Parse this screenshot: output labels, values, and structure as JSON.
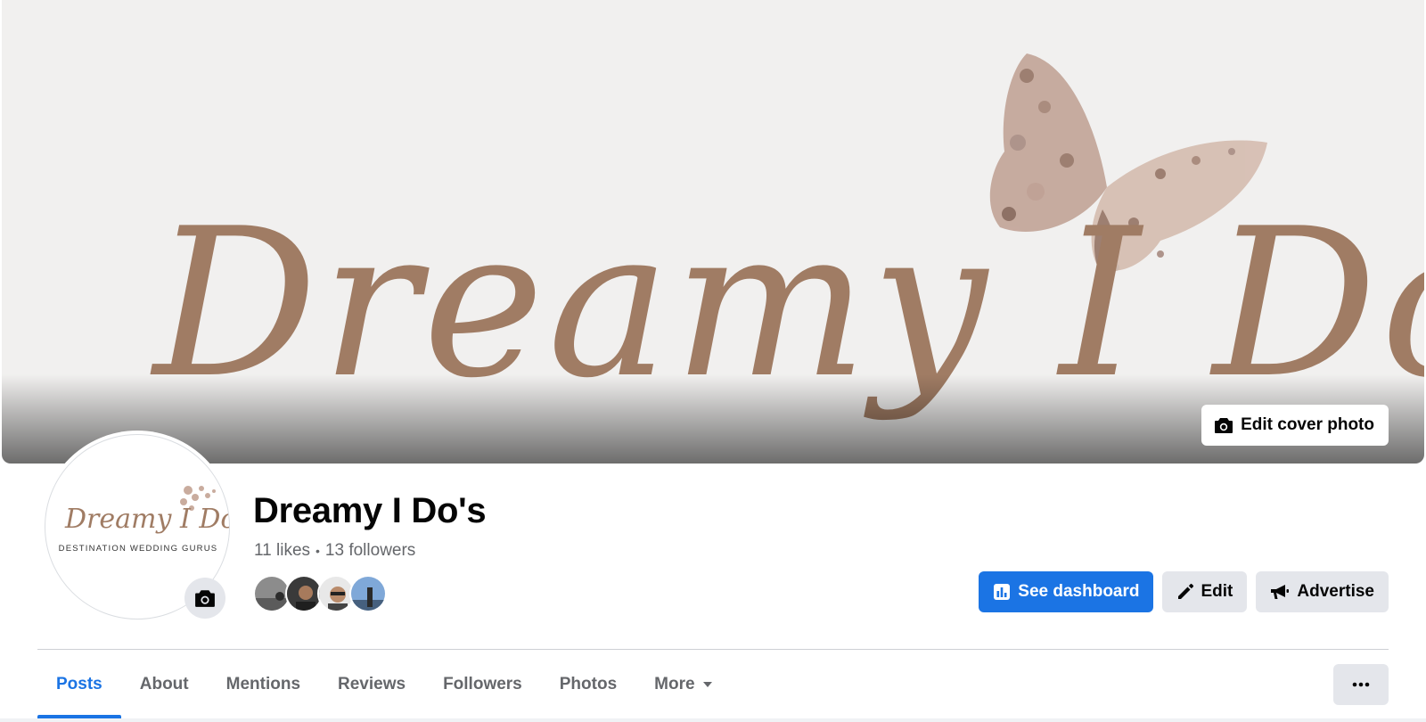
{
  "cover": {
    "artwork_text": "Dreamy I Do's",
    "edit_cover_label": "Edit cover photo"
  },
  "avatar": {
    "logo_script": "Dreamy I Do's",
    "logo_tagline": "DESTINATION WEDDING GURUS"
  },
  "page": {
    "name": "Dreamy I Do's",
    "likes": "11 likes",
    "separator": "•",
    "followers": "13 followers"
  },
  "actions": {
    "dashboard_label": "See dashboard",
    "edit_label": "Edit",
    "advertise_label": "Advertise"
  },
  "tabs": [
    {
      "label": "Posts",
      "active": true
    },
    {
      "label": "About"
    },
    {
      "label": "Mentions"
    },
    {
      "label": "Reviews"
    },
    {
      "label": "Followers"
    },
    {
      "label": "Photos"
    },
    {
      "label": "More"
    }
  ],
  "colors": {
    "accent": "#1b74e4",
    "script_brown": "#a07c64",
    "gray_button": "#e4e6eb",
    "secondary_text": "#65676b"
  },
  "icons": [
    "camera-icon",
    "dashboard-icon",
    "pencil-icon",
    "megaphone-icon",
    "caret-down-icon",
    "ellipsis-icon"
  ]
}
